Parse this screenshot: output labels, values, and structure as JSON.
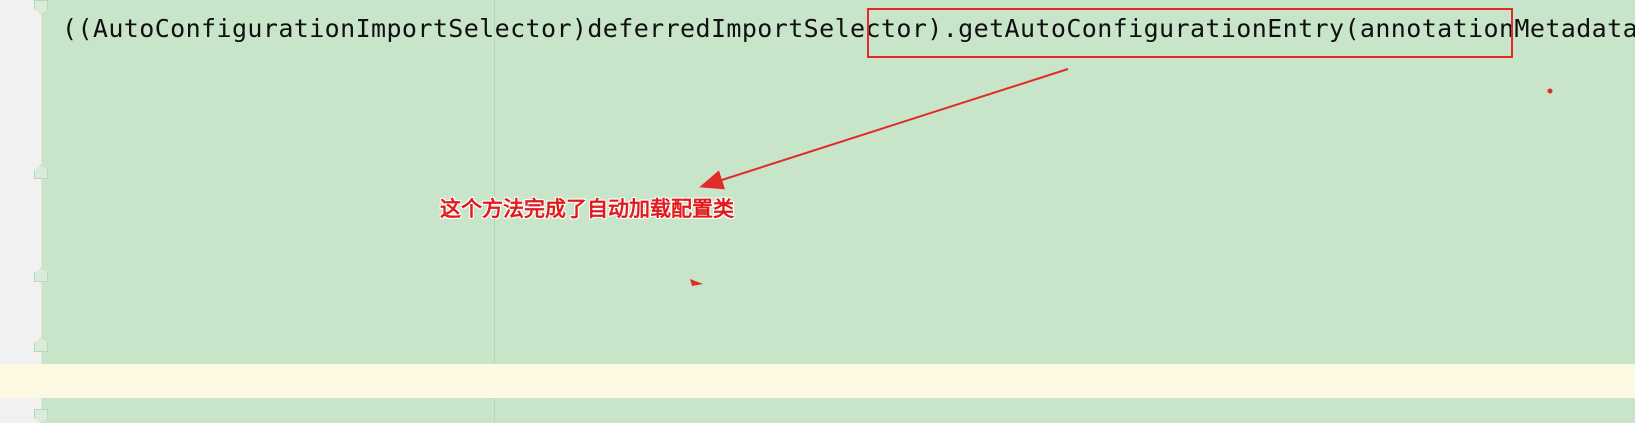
{
  "editor": {
    "code_line": "((AutoConfigurationImportSelector)deferredImportSelector).getAutoConfigurationEntry(annotationMetadata);"
  },
  "annotation": {
    "text": "这个方法完成了自动加载配置类",
    "color": "#e11b1b"
  },
  "colors": {
    "editor_background": "#c8e5c9",
    "current_line": "#fdf8e2",
    "gutter": "#f1f1f1"
  }
}
